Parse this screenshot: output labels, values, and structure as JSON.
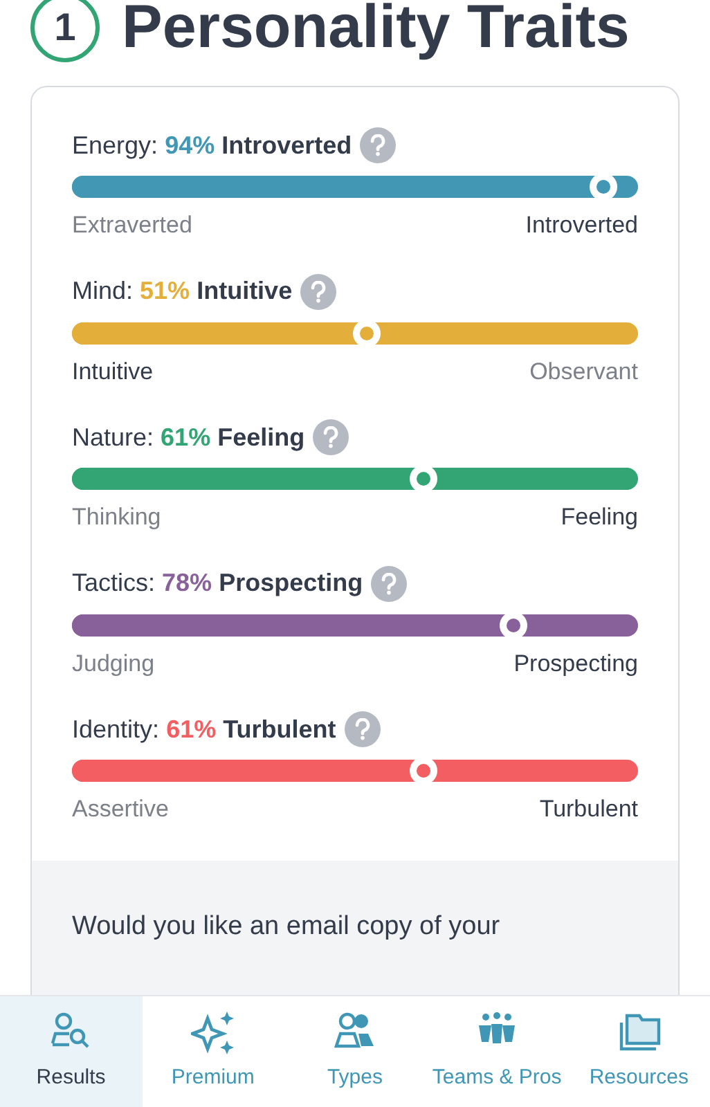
{
  "heading": {
    "step": "1",
    "title": "Personality Traits"
  },
  "traits": [
    {
      "label": "Energy:",
      "percent": "94%",
      "trait": "Introverted",
      "color": "#4298b4",
      "level": 0.94,
      "left": {
        "label": "Extraverted",
        "dominant": false
      },
      "right": {
        "label": "Introverted",
        "dominant": true
      }
    },
    {
      "label": "Mind:",
      "percent": "51%",
      "trait": "Intuitive",
      "color": "#e4ae3a",
      "level": 0.52,
      "left": {
        "label": "Intuitive",
        "dominant": true
      },
      "right": {
        "label": "Observant",
        "dominant": false
      }
    },
    {
      "label": "Nature:",
      "percent": "61%",
      "trait": "Feeling",
      "color": "#33a474",
      "level": 0.62,
      "left": {
        "label": "Thinking",
        "dominant": false
      },
      "right": {
        "label": "Feeling",
        "dominant": true
      }
    },
    {
      "label": "Tactics:",
      "percent": "78%",
      "trait": "Prospecting",
      "color": "#88619a",
      "level": 0.78,
      "left": {
        "label": "Judging",
        "dominant": false
      },
      "right": {
        "label": "Prospecting",
        "dominant": true
      }
    },
    {
      "label": "Identity:",
      "percent": "61%",
      "trait": "Turbulent",
      "color": "#f25e62",
      "level": 0.62,
      "left": {
        "label": "Assertive",
        "dominant": false
      },
      "right": {
        "label": "Turbulent",
        "dominant": true
      }
    }
  ],
  "email_prompt": "Would you like an email copy of your",
  "nav": [
    {
      "label": "Results",
      "kind": "results",
      "selected": true
    },
    {
      "label": "Premium",
      "kind": "premium",
      "selected": false
    },
    {
      "label": "Types",
      "kind": "types",
      "selected": false
    },
    {
      "label": "Teams & Pros",
      "kind": "teams",
      "selected": false
    },
    {
      "label": "Resources",
      "kind": "resources",
      "selected": false
    }
  ]
}
